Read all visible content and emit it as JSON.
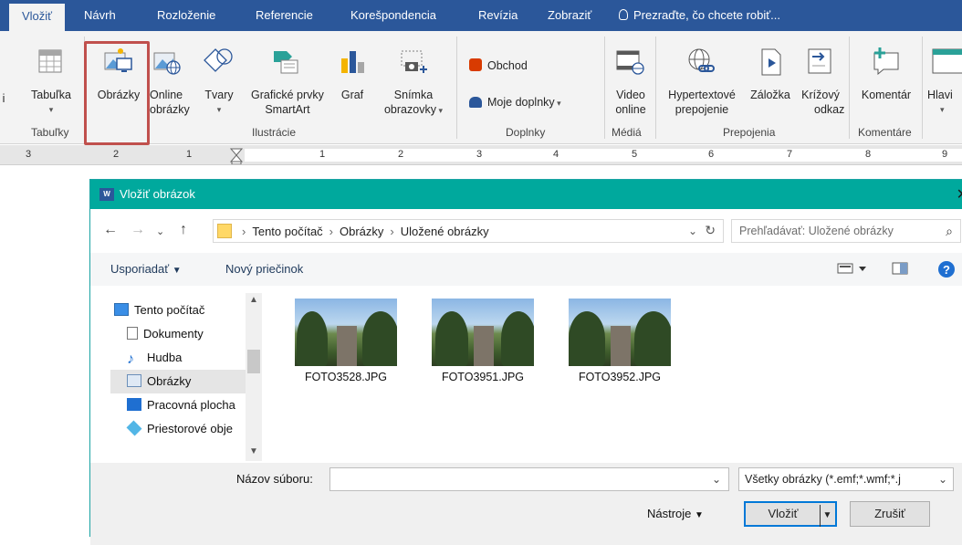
{
  "ribbon_tabs": [
    "Vložiť",
    "Návrh",
    "Rozloženie",
    "Referencie",
    "Korešpondencia",
    "Revízia",
    "Zobraziť"
  ],
  "tell_me": "Prezraďte, čo chcete robiť...",
  "ribbon": {
    "partial_left": "i",
    "table": "Tabuľka",
    "pictures": "Obrázky",
    "online_pictures_l1": "Online",
    "online_pictures_l2": "obrázky",
    "shapes": "Tvary",
    "smartart_l1": "Grafické prvky",
    "smartart_l2": "SmartArt",
    "chart": "Graf",
    "screenshot_l1": "Snímka",
    "screenshot_l2": "obrazovky",
    "store": "Obchod",
    "my_addins": "Moje doplnky",
    "video_l1": "Video",
    "video_l2": "online",
    "hyperlink_l1": "Hypertextové",
    "hyperlink_l2": "prepojenie",
    "bookmark": "Záložka",
    "crossref_l1": "Krížový",
    "crossref_l2": "odkaz",
    "comment": "Komentár",
    "header_partial": "Hlavi",
    "groups": {
      "tables": "Tabuľky",
      "illustrations": "Ilustrácie",
      "addins": "Doplnky",
      "media": "Médiá",
      "links": "Prepojenia",
      "comments": "Komentáre"
    }
  },
  "ruler": {
    "numbers": [
      "3",
      "2",
      "1",
      "1",
      "2",
      "3",
      "4",
      "5",
      "6",
      "7",
      "8",
      "9"
    ]
  },
  "dialog": {
    "title": "Vložiť obrázok",
    "breadcrumb": [
      "Tento počítač",
      "Obrázky",
      "Uložené obrázky"
    ],
    "search_placeholder": "Prehľadávať: Uložené obrázky",
    "organize": "Usporiadať",
    "new_folder": "Nový priečinok",
    "sidebar": [
      "Tento počítač",
      "Dokumenty",
      "Hudba",
      "Obrázky",
      "Pracovná plocha",
      "Priestorové obje"
    ],
    "selected_sidebar": "Obrázky",
    "files": [
      "FOTO3528.JPG",
      "FOTO3951.JPG",
      "FOTO3952.JPG"
    ],
    "filename_label": "Názov súboru:",
    "filename_value": "",
    "file_type": "Všetky obrázky (*.emf;*.wmf;*.j",
    "tools": "Nástroje",
    "insert": "Vložiť",
    "cancel": "Zrušiť"
  },
  "colors": {
    "ribbon_blue": "#2b579a",
    "dialog_title": "#00a99d",
    "highlight": "#c0504d"
  }
}
